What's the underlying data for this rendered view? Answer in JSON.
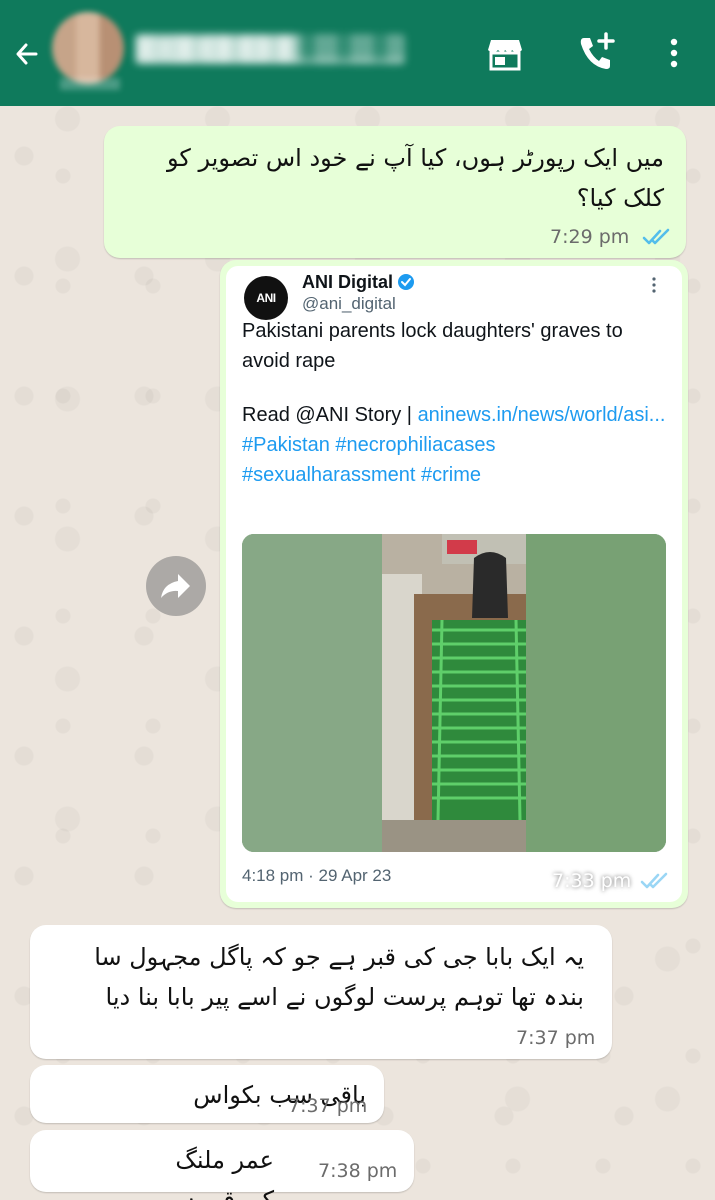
{
  "header": {
    "contact_name": "████████ ███████████████",
    "colors": {
      "bar": "#0f7a5c",
      "icon": "#ffffff"
    },
    "icons": [
      "back-arrow-icon",
      "store-icon",
      "add-call-icon",
      "more-vert-icon"
    ]
  },
  "messages": [
    {
      "direction": "out",
      "text": "میں ایک رپورٹر ہوں، کیا آپ نے خود اس تصویر کو کلک کیا؟",
      "time": "7:29 pm",
      "status": "read"
    },
    {
      "direction": "out",
      "type": "tweet-screenshot",
      "time": "7:33 pm",
      "status": "read",
      "tweet": {
        "logo_text": "ANI",
        "author": "ANI Digital",
        "handle": "@ani_digital",
        "headline": "Pakistani parents lock daughters' graves to avoid rape",
        "read_prefix": "Read @ANI Story | ",
        "link": "aninews.in/news/world/asi...",
        "hashtags_line1": "#Pakistan #necrophiliacases",
        "hashtags_line2": "#sexualharassment #crime",
        "date": "4:18 pm · 29 Apr 23"
      }
    },
    {
      "direction": "in",
      "text": "یہ ایک بابا جی کی قبر ہے جو کہ پاگل مجہول سا بندہ تھا توہم پرست لوگوں نے اسے پیر بابا بنا دیا",
      "time": "7:37 pm"
    },
    {
      "direction": "in",
      "text": "باقی سب بکواس ہے",
      "time": "7:37 pm"
    },
    {
      "direction": "in",
      "text": "عمر ملنگ کی قبر ہے یہ",
      "time": "7:38 pm"
    }
  ],
  "colors": {
    "outgoing_bubble": "#e7ffd8",
    "incoming_bubble": "#ffffff",
    "read_ticks": "#53bdeb",
    "link": "#1d9bf0",
    "wallpaper": "#ece5dd"
  }
}
